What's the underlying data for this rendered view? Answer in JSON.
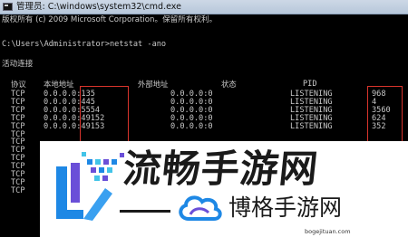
{
  "window": {
    "title": "管理员: C:\\windows\\system32\\cmd.exe"
  },
  "console": {
    "copyright_line": "版权所有 (c) 2009 Microsoft Corporation。保留所有权利。",
    "prompt_line": "C:\\Users\\Administrator>netstat -ano",
    "section_title": "活动连接",
    "headers": {
      "proto": "协议",
      "local": "本地地址",
      "foreign": "外部地址",
      "state": "状态",
      "pid": "PID"
    },
    "rows": [
      {
        "proto": "TCP",
        "local": "0.0.0.0:135",
        "foreign": "0.0.0.0:0",
        "state": "LISTENING",
        "pid": "968"
      },
      {
        "proto": "TCP",
        "local": "0.0.0.0:445",
        "foreign": "0.0.0.0:0",
        "state": "LISTENING",
        "pid": "4"
      },
      {
        "proto": "TCP",
        "local": "0.0.0.0:5554",
        "foreign": "0.0.0.0:0",
        "state": "LISTENING",
        "pid": "3560"
      },
      {
        "proto": "TCP",
        "local": "0.0.0.0:49152",
        "foreign": "0.0.0.0:0",
        "state": "LISTENING",
        "pid": "624"
      },
      {
        "proto": "TCP",
        "local": "0.0.0.0:49153",
        "foreign": "0.0.0.0:0",
        "state": "LISTENING",
        "pid": "352"
      },
      {
        "proto": "TCP",
        "local": "",
        "foreign": "",
        "state": "",
        "pid": ""
      },
      {
        "proto": "TCP",
        "local": "",
        "foreign": "",
        "state": "",
        "pid": ""
      },
      {
        "proto": "TCP",
        "local": "",
        "foreign": "",
        "state": "",
        "pid": ""
      },
      {
        "proto": "TCP",
        "local": "",
        "foreign": "",
        "state": "",
        "pid": ""
      },
      {
        "proto": "TCP",
        "local": "",
        "foreign": "",
        "state": "",
        "pid": ""
      },
      {
        "proto": "TCP",
        "local": "",
        "foreign": "",
        "state": "",
        "pid": ""
      },
      {
        "proto": "TCP",
        "local": "",
        "foreign": "",
        "state": "",
        "pid": ""
      },
      {
        "proto": "TCP",
        "local": "",
        "foreign": "",
        "state": "",
        "pid": ""
      }
    ]
  },
  "watermark": {
    "brand": "流畅手游网",
    "sub_brand": "博格手游网",
    "domain": "bogejituan.com"
  },
  "colors": {
    "console_bg": "#000000",
    "console_text": "#c8c8c8",
    "highlight": "#d8342c",
    "logo_blue": "#1e88e5",
    "logo_purple": "#6a4fd8"
  }
}
